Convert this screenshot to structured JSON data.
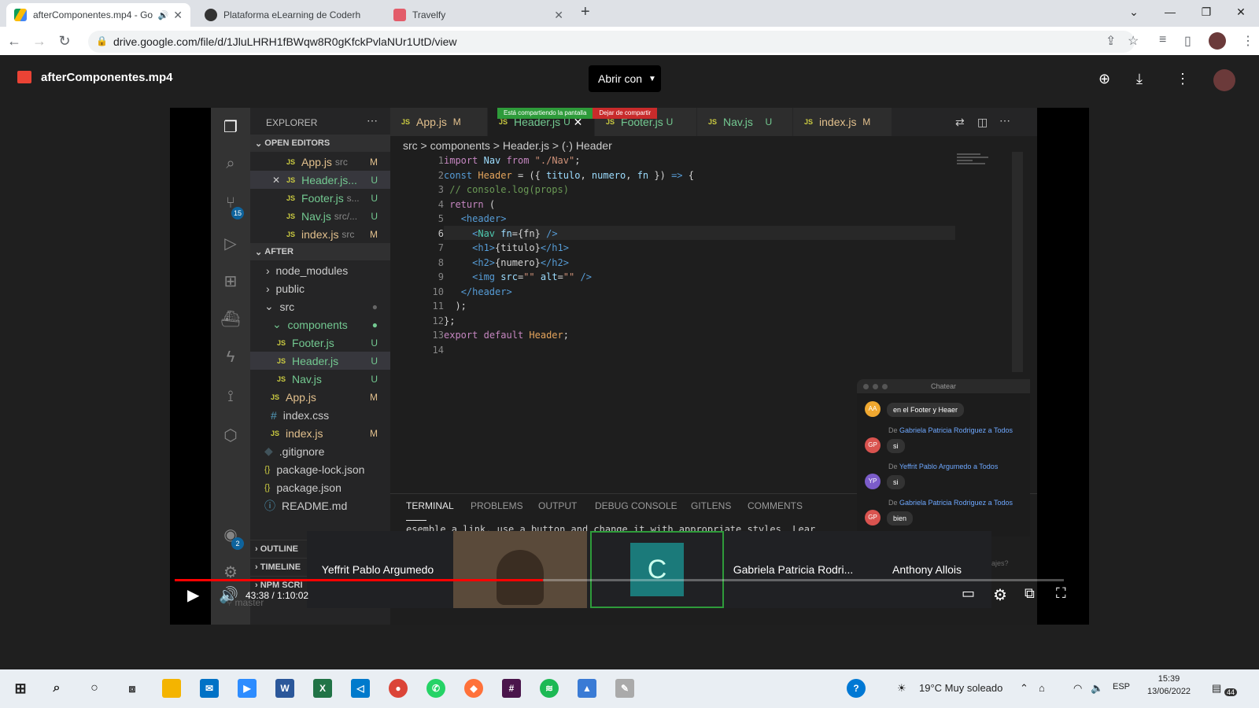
{
  "browser": {
    "tabs": [
      {
        "title": "afterComponentes.mp4 - Go",
        "active": true
      },
      {
        "title": "Plataforma eLearning de Coderh",
        "active": false
      },
      {
        "title": "Travelfy",
        "active": false
      }
    ],
    "url": "drive.google.com/file/d/1JluLHRH1fBWqw8R0gKfckPvlaNUr1UtD/view"
  },
  "drive": {
    "file_title": "afterComponentes.mp4",
    "open_with_label": "Abrir con"
  },
  "vscode": {
    "explorer_title": "EXPLORER",
    "open_editors_label": "OPEN EDITORS",
    "open_editors": [
      {
        "name": "App.js",
        "path": "src",
        "status": "M"
      },
      {
        "name": "Header.js...",
        "path": "",
        "status": "U"
      },
      {
        "name": "Footer.js",
        "path": "s...",
        "status": "U"
      },
      {
        "name": "Nav.js",
        "path": "src/...",
        "status": "U"
      },
      {
        "name": "index.js",
        "path": "src",
        "status": "M"
      }
    ],
    "folder_label": "AFTER",
    "tree": [
      {
        "name": "node_modules",
        "status": ""
      },
      {
        "name": "public",
        "status": ""
      },
      {
        "name": "src",
        "status": ""
      },
      {
        "name": "components",
        "status": ""
      },
      {
        "name": "Footer.js",
        "status": "U"
      },
      {
        "name": "Header.js",
        "status": "U"
      },
      {
        "name": "Nav.js",
        "status": "U"
      },
      {
        "name": "App.js",
        "status": "M"
      },
      {
        "name": "index.css",
        "status": ""
      },
      {
        "name": "index.js",
        "status": "M"
      },
      {
        "name": ".gitignore",
        "status": ""
      },
      {
        "name": "package-lock.json",
        "status": ""
      },
      {
        "name": "package.json",
        "status": ""
      },
      {
        "name": "README.md",
        "status": ""
      }
    ],
    "outline_label": "OUTLINE",
    "timeline_label": "TIMELINE",
    "npm_label": "NPM SCRI",
    "branch": "master",
    "scm_badge": "15",
    "account_badge": "2",
    "editor_tabs": [
      {
        "name": "App.js",
        "status": "M"
      },
      {
        "name": "Header.js",
        "status": "U"
      },
      {
        "name": "Footer.js",
        "status": "U"
      },
      {
        "name": "Nav.js",
        "status": "U"
      },
      {
        "name": "index.js",
        "status": "M"
      }
    ],
    "share_banner": "Está compartiendo la pantalla",
    "stop_share": "Dejar de compartir",
    "breadcrumb": "src > components > Header.js > (·) Header",
    "line_numbers": [
      "1",
      "2",
      "3",
      "4",
      "5",
      "6",
      "7",
      "8",
      "9",
      "10",
      "11",
      "12",
      "13",
      "14"
    ],
    "panel_tabs": [
      "TERMINAL",
      "PROBLEMS",
      "OUTPUT",
      "DEBUG CONSOLE",
      "GITLENS",
      "COMMENTS"
    ],
    "terminal_text": "esemble a link, use a button and change it with appropriate styles. Lear"
  },
  "chat": {
    "title": "Chatear",
    "messages": [
      {
        "initials": "AA",
        "from": "",
        "text": "en el Footer y Heaer",
        "color": "#f0a830"
      },
      {
        "initials": "GP",
        "from": "Gabriela Patricia Rodriguez",
        "text": "si",
        "color": "#d9534f"
      },
      {
        "initials": "YP",
        "from": "Yeffrit Pablo Argumedo",
        "text": "si",
        "color": "#7b5cc9"
      },
      {
        "initials": "GP",
        "from": "Gabriela Patricia Rodriguez",
        "text": "bien",
        "color": "#d9534f"
      }
    ],
    "de_label": "De",
    "a_todos": "a Todos",
    "hint": "ajes?"
  },
  "participants": [
    {
      "name": "Yeffrit Pablo Argumedo"
    },
    {
      "name": ""
    },
    {
      "name": "C"
    },
    {
      "name": "Gabriela Patricia Rodri..."
    },
    {
      "name": "Anthony Allois"
    }
  ],
  "player": {
    "time": "43:38 / 1:10:02",
    "progress_fraction": 0.414
  },
  "taskbar": {
    "weather": "19°C  Muy soleado",
    "lang": "ESP",
    "clock_time": "15:39",
    "clock_date": "13/06/2022",
    "notif_count": "44"
  }
}
